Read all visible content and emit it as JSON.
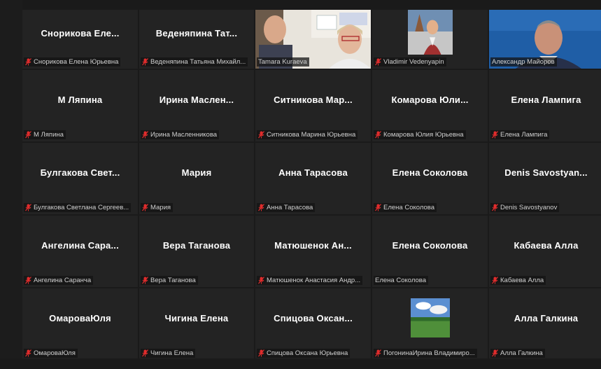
{
  "window": {
    "title": ""
  },
  "colors": {
    "background": "#1a1a1a",
    "tile": "#232323",
    "mic_muted": "#e02c2c",
    "active_border": "#d9e03a"
  },
  "participants": [
    {
      "display": "Снорикова  Еле...",
      "name": "Снорикова Елена Юрьевна",
      "muted": true,
      "video": false
    },
    {
      "display": "Веденяпина  Тат...",
      "name": "Веденяпина Татьяна Михайл...",
      "muted": true,
      "video": false
    },
    {
      "display": "",
      "name": "Tamara Kuraeva",
      "muted": false,
      "video": true
    },
    {
      "display": "",
      "name": "Vladimir Vedenyapin",
      "muted": true,
      "video": true
    },
    {
      "display": "",
      "name": "Александр Майоров",
      "muted": false,
      "video": true,
      "active": true
    },
    {
      "display": "М Ляпина",
      "name": "М Ляпина",
      "muted": true,
      "video": false
    },
    {
      "display": "Ирина  Маслен...",
      "name": "Ирина Масленникова",
      "muted": true,
      "video": false
    },
    {
      "display": "Ситникова  Мар...",
      "name": "Ситникова Марина Юрьевна",
      "muted": true,
      "video": false
    },
    {
      "display": "Комарова  Юли...",
      "name": "Комарова Юлия Юрьевна",
      "muted": true,
      "video": false
    },
    {
      "display": "Елена Лампига",
      "name": "Елена Лампига",
      "muted": true,
      "video": false
    },
    {
      "display": "Булгакова  Свет...",
      "name": "Булгакова Светлана Сергеев...",
      "muted": true,
      "video": false
    },
    {
      "display": "Мария",
      "name": "Мария",
      "muted": true,
      "video": false
    },
    {
      "display": "Анна Тарасова",
      "name": "Анна Тарасова",
      "muted": true,
      "video": false
    },
    {
      "display": "Елена Соколова",
      "name": "Елена Соколова",
      "muted": true,
      "video": false
    },
    {
      "display": "Denis  Savostyan...",
      "name": "Denis Savostyanov",
      "muted": true,
      "video": false
    },
    {
      "display": "Ангелина  Сара...",
      "name": "Ангелина Саранча",
      "muted": true,
      "video": false
    },
    {
      "display": "Вера Таганова",
      "name": "Вера Таганова",
      "muted": true,
      "video": false
    },
    {
      "display": "Матюшенок  Ан...",
      "name": "Матюшенок Анастасия Андр...",
      "muted": true,
      "video": false
    },
    {
      "display": "Елена Соколова",
      "name": "Елена Соколова",
      "muted": false,
      "video": false
    },
    {
      "display": "Кабаева Алла",
      "name": "Кабаева Алла",
      "muted": true,
      "video": false
    },
    {
      "display": "ОмароваЮля",
      "name": "ОмароваЮля",
      "muted": true,
      "video": false
    },
    {
      "display": "Чигина Елена",
      "name": "Чигина Елена",
      "muted": true,
      "video": false
    },
    {
      "display": "Спицова  Оксан...",
      "name": "Спицова Оксана Юрьевна",
      "muted": true,
      "video": false
    },
    {
      "display": "",
      "name": "ПогонинаИрина Владимиро...",
      "muted": true,
      "video": true
    },
    {
      "display": "Алла Галкина",
      "name": "Алла Галкина",
      "muted": true,
      "video": false
    }
  ]
}
